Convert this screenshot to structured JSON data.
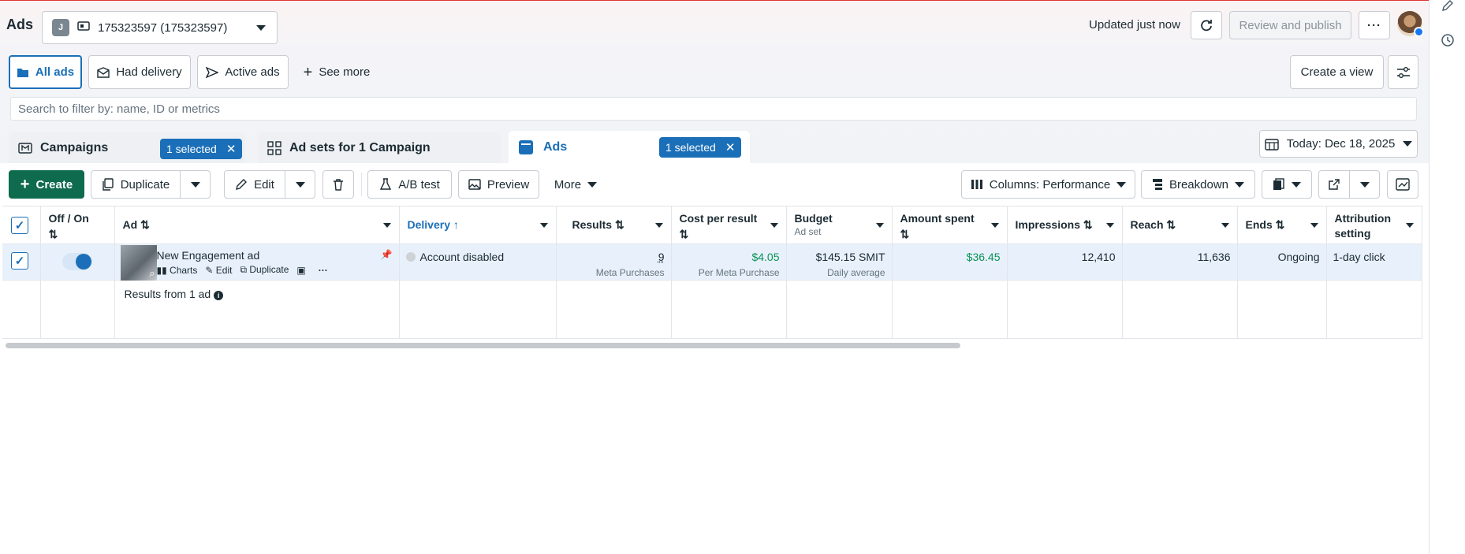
{
  "header": {
    "title": "Ads",
    "account_initial": "J",
    "account_name": "175323597 (175323597)",
    "updated": "Updated just now",
    "review_publish": "Review and publish"
  },
  "filters": {
    "all_ads": "All ads",
    "had_delivery": "Had delivery",
    "active_ads": "Active ads",
    "see_more": "See more",
    "create_view": "Create a view"
  },
  "search": {
    "placeholder": "Search to filter by: name, ID or metrics"
  },
  "tabs": {
    "campaigns": "Campaigns",
    "campaigns_selected": "1 selected",
    "adsets": "Ad sets for 1 Campaign",
    "ads": "Ads",
    "ads_selected": "1 selected",
    "date": "Today: Dec 18, 2025"
  },
  "toolbar": {
    "create": "Create",
    "duplicate": "Duplicate",
    "edit": "Edit",
    "ab_test": "A/B test",
    "preview": "Preview",
    "more": "More",
    "columns": "Columns: Performance",
    "breakdown": "Breakdown"
  },
  "table": {
    "columns": {
      "off_on": "Off / On",
      "ad": "Ad",
      "delivery": "Delivery",
      "results": "Results",
      "cost": "Cost per result",
      "budget": "Budget",
      "budget_sub": "Ad set",
      "amount": "Amount spent",
      "impressions": "Impressions",
      "reach": "Reach",
      "ends": "Ends",
      "attribution": "Attribution setting"
    },
    "row": {
      "name": "New Engagement ad",
      "action_charts": "Charts",
      "action_edit": "Edit",
      "action_duplicate": "Duplicate",
      "delivery": "Account disabled",
      "results": "9",
      "results_sub": "Meta Purchases",
      "cost": "$4.05",
      "cost_sub": "Per Meta Purchase",
      "budget": "$145.15 SMIT",
      "budget_sub": "Daily average",
      "amount": "$36.45",
      "impressions": "12,410",
      "reach": "11,636",
      "ends": "Ongoing",
      "attribution": "1-day click",
      "toggle_on": true
    },
    "footer": "Results from 1 ad"
  },
  "colors": {
    "accent": "#1a6fb8",
    "primary": "#0e6b4d",
    "positive": "#0a9256"
  }
}
